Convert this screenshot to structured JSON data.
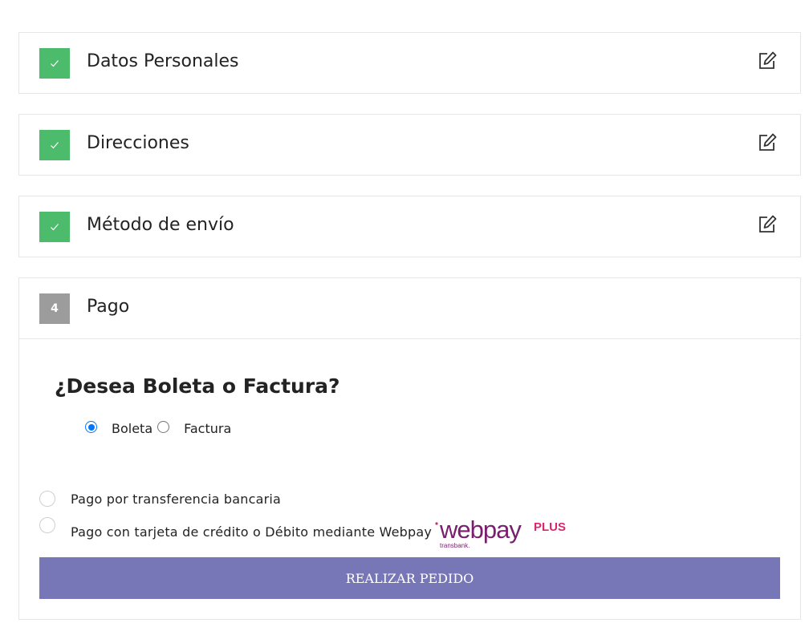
{
  "steps": [
    {
      "title": "Datos Personales",
      "status": "complete",
      "icon": "check-icon"
    },
    {
      "title": "Direcciones",
      "status": "complete",
      "icon": "check-icon"
    },
    {
      "title": "Método de envío",
      "status": "complete",
      "icon": "check-icon"
    },
    {
      "title": "Pago",
      "status": "current",
      "number": "4"
    }
  ],
  "payment": {
    "invoice_question": "¿Desea Boleta o Factura?",
    "doc_options": [
      {
        "label": "Boleta",
        "checked": true
      },
      {
        "label": "Factura",
        "checked": false
      }
    ],
    "methods": [
      {
        "label": "Pago por transferencia bancaria",
        "checked": false
      },
      {
        "label": "Pago con tarjeta de crédito o Débito mediante Webpay",
        "checked": false
      }
    ],
    "webpay_logo": {
      "main": "webpay",
      "suffix": "PLUS",
      "sub": "transbank."
    },
    "submit_label": "REALIZAR PEDIDO"
  },
  "colors": {
    "complete_badge": "#4cbb6c",
    "pending_badge": "#9c9c9c",
    "submit_button": "#7777b8",
    "radio_accent": "#0075ff",
    "webpay_brand": "#7a1e6e",
    "webpay_plus": "#d6286e"
  },
  "icons": {
    "edit": "edit-icon",
    "check": "check-icon"
  }
}
